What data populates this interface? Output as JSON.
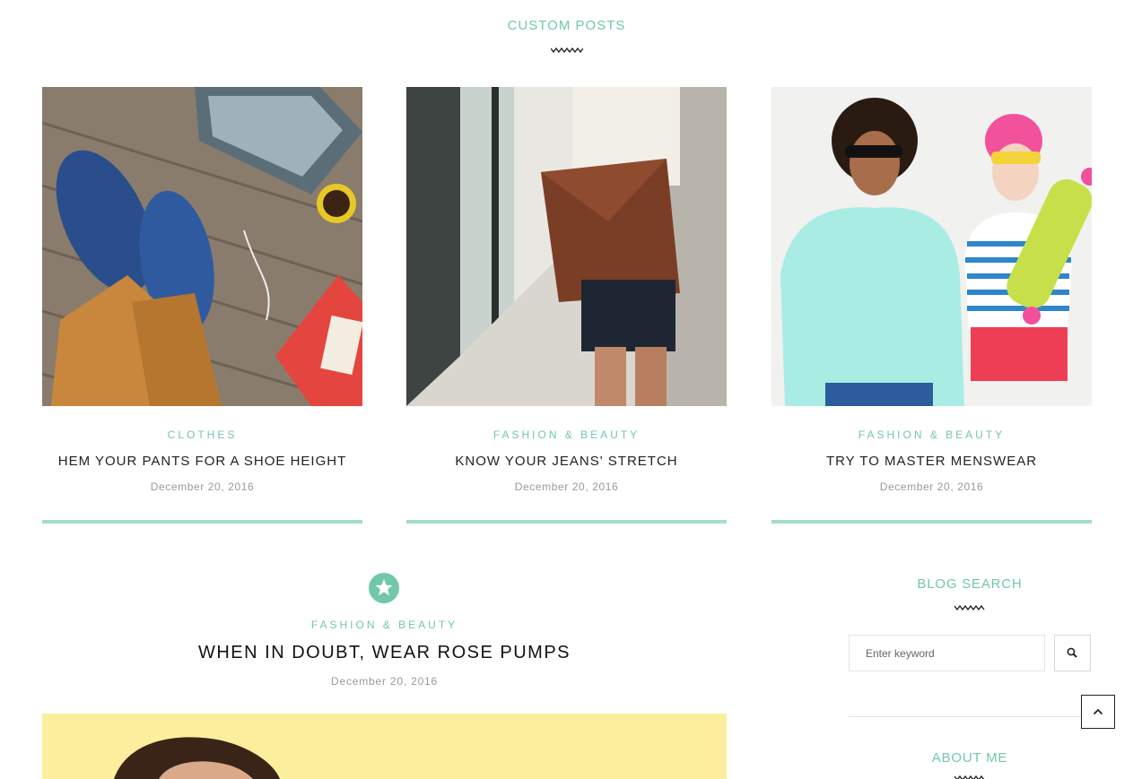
{
  "custom_posts": {
    "section_title": "CUSTOM POSTS",
    "posts": [
      {
        "category": "CLOTHES",
        "title": "HEM YOUR PANTS FOR A SHOE HEIGHT",
        "date": "December 20, 2016"
      },
      {
        "category": "FASHION & BEAUTY",
        "title": "KNOW YOUR JEANS' STRETCH",
        "date": "December 20, 2016"
      },
      {
        "category": "FASHION & BEAUTY",
        "title": "TRY TO MASTER MENSWEAR",
        "date": "December 20, 2016"
      }
    ]
  },
  "featured_post": {
    "icon": "star-icon",
    "category": "FASHION & BEAUTY",
    "title": "WHEN IN DOUBT, WEAR ROSE PUMPS",
    "date": "December 20, 2016"
  },
  "sidebar": {
    "blog_search": {
      "title": "BLOG SEARCH",
      "placeholder": "Enter keyword",
      "button_icon": "search-icon"
    },
    "about_me": {
      "title": "ABOUT ME"
    }
  },
  "back_to_top": {
    "icon": "chevron-up-icon"
  },
  "colors": {
    "accent": "#72c7a9",
    "accent_light": "#a5dcc5",
    "text": "#222222",
    "muted": "#999999"
  }
}
